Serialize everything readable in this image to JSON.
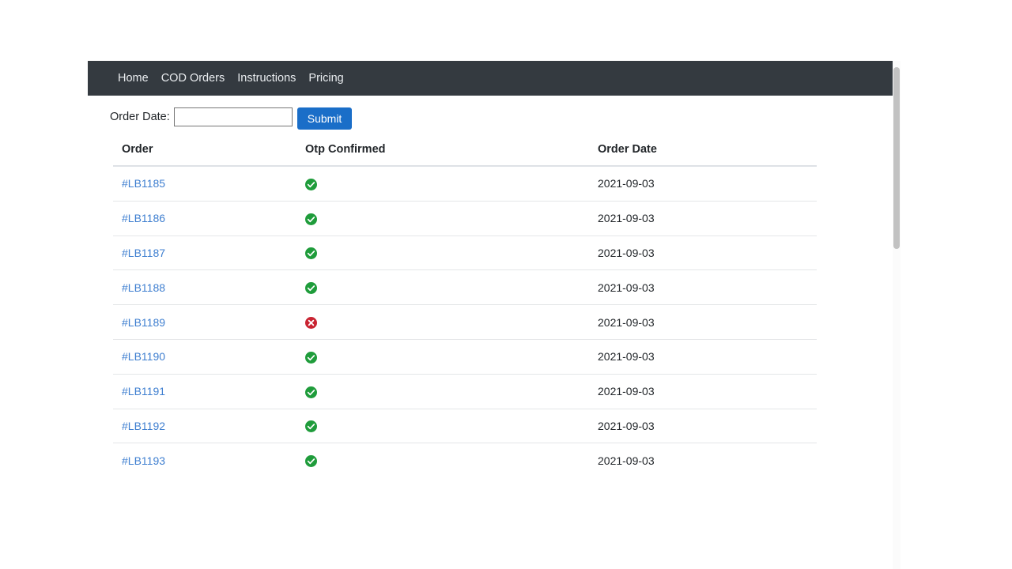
{
  "navbar": {
    "items": [
      {
        "label": "Home"
      },
      {
        "label": "COD Orders"
      },
      {
        "label": "Instructions"
      },
      {
        "label": "Pricing"
      }
    ],
    "background_color": "#343a40",
    "link_color": "#e9ecef"
  },
  "filter": {
    "date_label": "Order Date:",
    "date_value": "",
    "date_placeholder": "",
    "submit_label": "Submit",
    "submit_color": "#1a6ec8"
  },
  "table": {
    "columns": [
      "Order",
      "Otp Confirmed",
      "Order Date"
    ],
    "rows": [
      {
        "order": "#LB1185",
        "otp_confirmed": true,
        "order_date": "2021-09-03"
      },
      {
        "order": "#LB1186",
        "otp_confirmed": true,
        "order_date": "2021-09-03"
      },
      {
        "order": "#LB1187",
        "otp_confirmed": true,
        "order_date": "2021-09-03"
      },
      {
        "order": "#LB1188",
        "otp_confirmed": true,
        "order_date": "2021-09-03"
      },
      {
        "order": "#LB1189",
        "otp_confirmed": false,
        "order_date": "2021-09-03"
      },
      {
        "order": "#LB1190",
        "otp_confirmed": true,
        "order_date": "2021-09-03"
      },
      {
        "order": "#LB1191",
        "otp_confirmed": true,
        "order_date": "2021-09-03"
      },
      {
        "order": "#LB1192",
        "otp_confirmed": true,
        "order_date": "2021-09-03"
      },
      {
        "order": "#LB1193",
        "otp_confirmed": true,
        "order_date": "2021-09-03"
      }
    ],
    "icons": {
      "confirmed": "check-circle-icon",
      "not_confirmed": "times-circle-icon"
    },
    "colors": {
      "confirmed": "#1f9c3b",
      "not_confirmed": "#c92432",
      "link": "#3f7fd0"
    }
  },
  "scrollbar": {
    "orientation": "vertical",
    "thumb_color": "#c2c2c2"
  }
}
